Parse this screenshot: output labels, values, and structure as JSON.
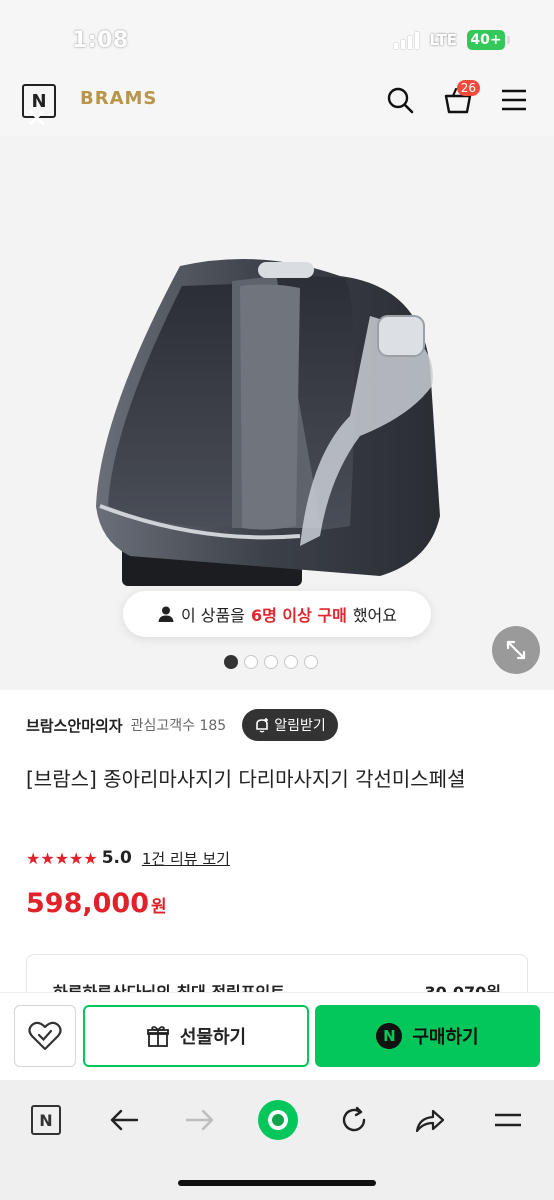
{
  "status_bar": {
    "time": "1:08",
    "network": "LTE",
    "battery": "40+"
  },
  "header": {
    "n_logo": "N",
    "brand": "BRAMS",
    "cart_count": "26"
  },
  "product_image": {
    "buyer_notice_prefix": "이 상품을",
    "buyer_notice_highlight": "6명 이상 구매",
    "buyer_notice_suffix": "했어요",
    "slide_count": 5,
    "active_slide": 0
  },
  "seller": {
    "name": "브람스안마의자",
    "fans_label": "관심고객수 185",
    "alarm_label": "알림받기"
  },
  "product": {
    "title": "[브람스] 종아리마사지기 다리마사지기 각선미스페셜",
    "stars": "★★★★★",
    "rating": "5.0",
    "review_link": "1건 리뷰 보기",
    "price": "598,000",
    "price_unit": "원"
  },
  "points": {
    "label": "하루하루산다님의 최대 적립포인트",
    "value": "30,070원"
  },
  "buy_bar": {
    "gift_label": "선물하기",
    "purchase_label": "구매하기",
    "npay_logo": "N"
  },
  "browser_toolbar": {
    "n_logo": "N"
  },
  "colors": {
    "naver_green": "#03c75a",
    "price_red": "#e2212b",
    "brand_gold": "#b89548",
    "badge_red": "#f04b3c"
  }
}
